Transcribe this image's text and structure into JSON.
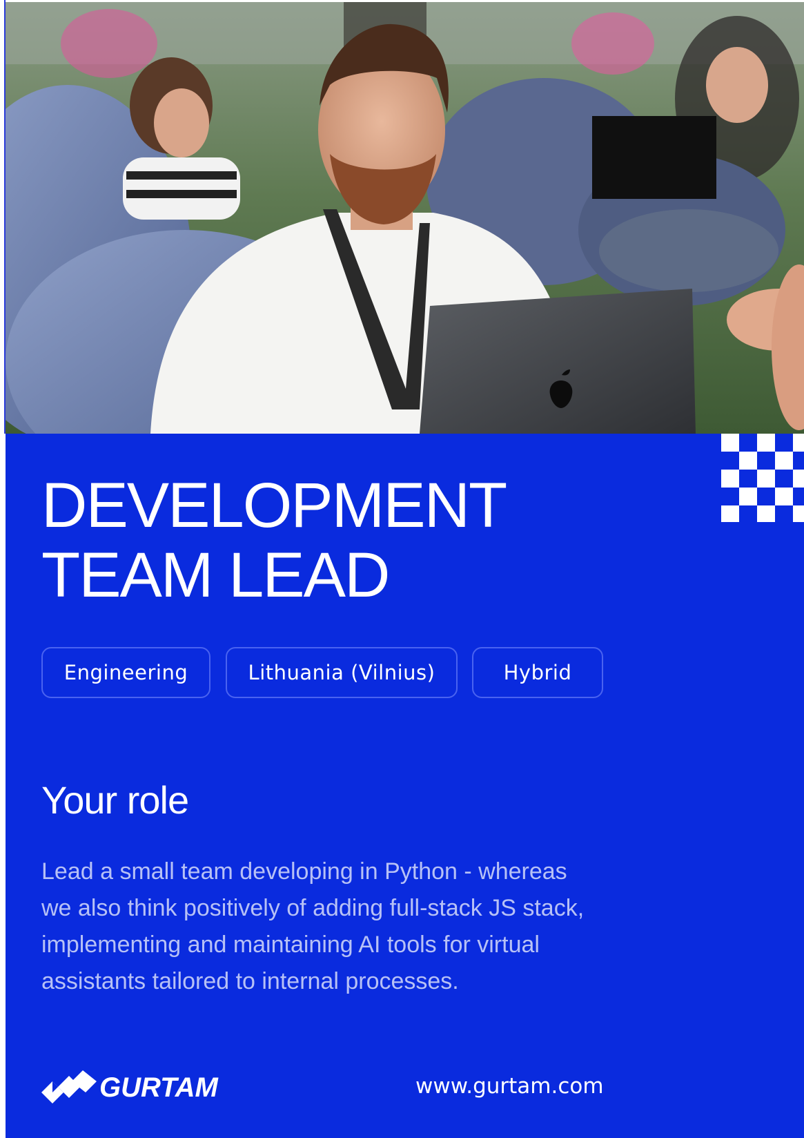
{
  "photo": {
    "description_icon": "team-photo"
  },
  "job": {
    "title_line1": "DEVELOPMENT",
    "title_line2": "TEAM LEAD"
  },
  "tags": [
    "Engineering",
    "Lithuania (Vilnius)",
    "Hybrid"
  ],
  "role": {
    "heading": "Your role",
    "lines": [
      "Lead a small team developing in Python - whereas",
      "we also think positively of adding full-stack JS stack,",
      "implementing and maintaining AI tools for virtual",
      "assistants tailored to internal processes."
    ]
  },
  "footer": {
    "logo_text": "GURTAM",
    "website": "www.gurtam.com"
  },
  "colors": {
    "brand_blue": "#0a2bde",
    "body_text": "#b7c1f6",
    "tag_border": "#4a63f0"
  }
}
